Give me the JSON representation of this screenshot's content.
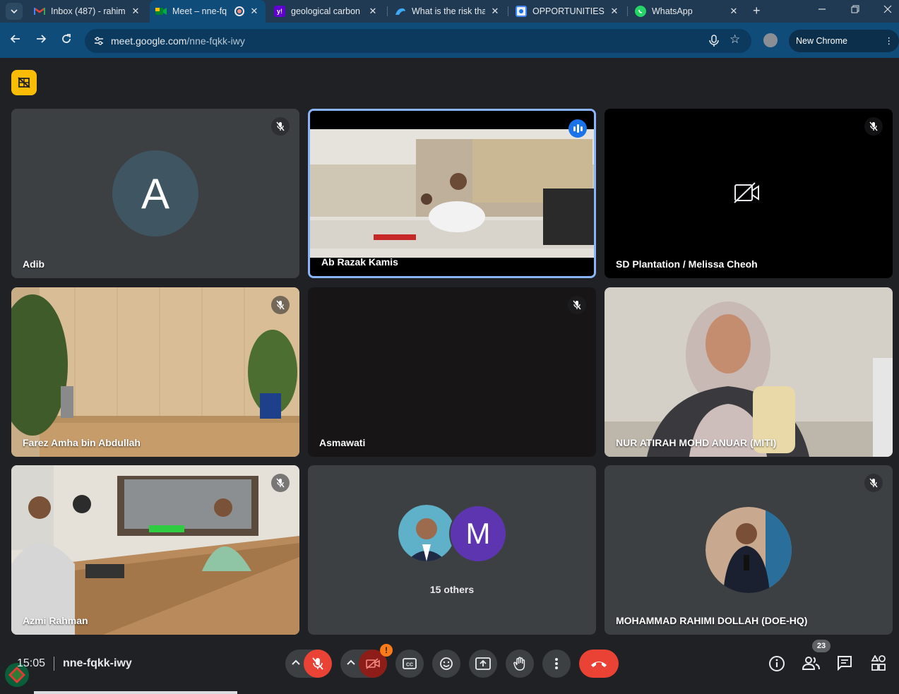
{
  "browser": {
    "tabs": [
      {
        "title": "Inbox (487) - rahim",
        "icon": "gmail-icon"
      },
      {
        "title": "Meet – nne-fq",
        "icon": "meet-icon",
        "active": true
      },
      {
        "title": "geological carbon",
        "icon": "yahoo-icon"
      },
      {
        "title": "What is the risk tha",
        "icon": "copilot-icon"
      },
      {
        "title": "OPPORTUNITIES F",
        "icon": "site-icon"
      },
      {
        "title": "WhatsApp",
        "icon": "whatsapp-icon"
      }
    ],
    "url_host": "meet.google.com",
    "url_path": "/nne-fqkk-iwy",
    "update_label": "New Chrome available"
  },
  "meeting": {
    "tiles": [
      {
        "name": "Adib",
        "initial": "A",
        "muted": true,
        "video": "avatar",
        "avatar_color": "#3f5562"
      },
      {
        "name": "Ab Razak Kamis",
        "muted": false,
        "speaking": true,
        "video": "camera-meeting-room"
      },
      {
        "name": "SD Plantation / Melissa Cheoh",
        "muted": true,
        "video": "camera-off"
      },
      {
        "name": "Farez Amha bin Abdullah",
        "muted": true,
        "video": "camera-interior"
      },
      {
        "name": "Asmawati",
        "muted": true,
        "video": "black"
      },
      {
        "name": "NUR ATIRAH MOHD ANUAR (MITI)",
        "muted": false,
        "video": "camera-person"
      },
      {
        "name": "Azmi Rahman",
        "muted": true,
        "video": "camera-meeting-room"
      },
      {
        "name": "15 others",
        "initial": "M",
        "video": "others",
        "avatar_color": "#5e35b1"
      },
      {
        "name": "MOHAMMAD RAHIMI DOLLAH (DOE-HQ)",
        "muted": true,
        "video": "avatar-photo"
      }
    ],
    "time": "15:05",
    "code": "nne-fqkk-iwy",
    "participant_count": "23"
  },
  "colors": {
    "meet_bg": "#202124",
    "tile_bg": "#3c4043",
    "hangup": "#ea4335",
    "speaking": "#1a73e8",
    "highlight": "#8ab4f8",
    "badge": "#fbbc04"
  }
}
